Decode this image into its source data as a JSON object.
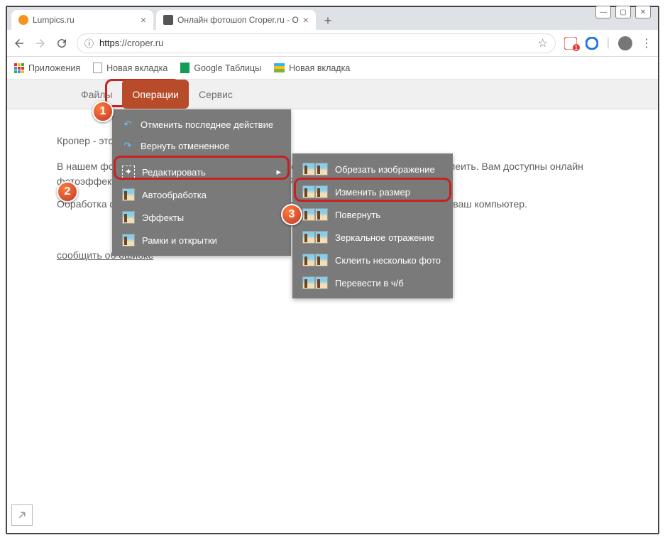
{
  "window": {
    "minimize": "—",
    "maximize": "▢",
    "close": "✕"
  },
  "tabs": [
    {
      "title": "Lumpics.ru",
      "active": false
    },
    {
      "title": "Онлайн фотошоп Croper.ru - О",
      "active": true
    }
  ],
  "tab_plus": "+",
  "nav": {
    "url_info": "ⓘ",
    "url_scheme": "https",
    "url_host": "://croper.ru",
    "star": "☆"
  },
  "bookmarks": {
    "apps": "Приложения",
    "new_tab_1": "Новая вкладка",
    "sheets": "Google Таблицы",
    "new_tab_2": "Новая вкладка"
  },
  "site_nav": {
    "files": "Файлы",
    "operations": "Операции",
    "service": "Сервис"
  },
  "content": {
    "intro": "Кропер - это онлайн фотошоп",
    "p1": "В нашем фоторедакторе вы можете: обрезать фото, изменить размер, повернуть, склеить. Вам доступны онлайн фотоэффекты — можно сделать аватарку из своей фотографии.",
    "p2": "Обработка фотографий с кропером бесплатна и не требует установки программы на ваш компьютер.",
    "report": "сообщить об ошибке"
  },
  "menu1": {
    "undo": "Отменить последнее действие",
    "redo": "Вернуть отмененное",
    "edit": "Редактировать",
    "auto": "Автообработка",
    "effects": "Эффекты",
    "frames": "Рамки и открытки"
  },
  "menu2": {
    "crop": "Обрезать изображение",
    "resize": "Изменить размер",
    "rotate": "Повернуть",
    "mirror": "Зеркальное отражение",
    "merge": "Склеить несколько фото",
    "bw": "Перевести в ч/б"
  },
  "markers": {
    "m1": "1",
    "m2": "2",
    "m3": "3"
  }
}
